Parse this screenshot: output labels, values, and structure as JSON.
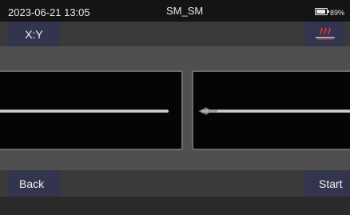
{
  "status_bar": {
    "datetime": "2023-06-21 13:05",
    "fiber_mode": "SM_SM",
    "battery_percent": "89%",
    "battery_level": 0.89
  },
  "buttons": {
    "xy_label": "X:Y",
    "back_label": "Back",
    "start_label": "Start",
    "heater_icon": "heater-icon"
  },
  "colors": {
    "button_bg": "#33344e",
    "status_bg": "#141414",
    "content_bg": "#4f4f4f",
    "heater_red": "#e03a3a"
  }
}
